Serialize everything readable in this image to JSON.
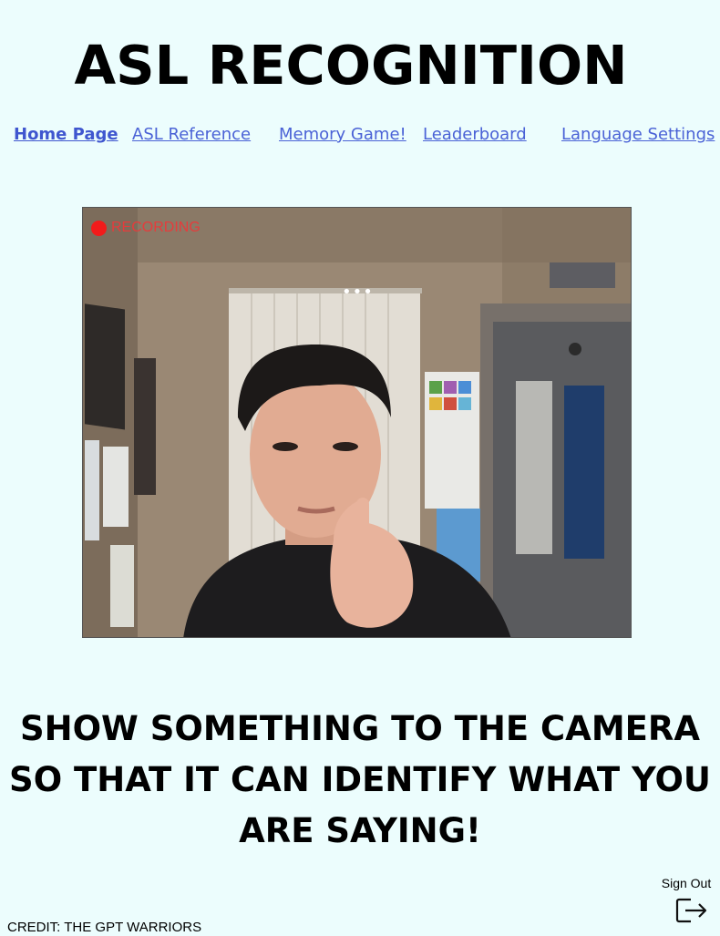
{
  "app": {
    "title": "ASL RECOGNITION"
  },
  "nav": {
    "items": [
      {
        "label": "Home Page",
        "active": true
      },
      {
        "label": "ASL Reference",
        "active": false
      },
      {
        "label": "Memory Game!",
        "active": false
      },
      {
        "label": "Leaderboard",
        "active": false
      },
      {
        "label": "Language Settings",
        "active": false
      }
    ]
  },
  "camera": {
    "status_label": "RECORDING",
    "status_color": "#f21b1b",
    "menu_icon": "more-horizontal-icon"
  },
  "prompt": {
    "lines": [
      "SHOW SOMETHING TO THE CAMERA",
      "SO THAT IT CAN IDENTIFY WHAT YOU",
      "ARE SAYING!"
    ]
  },
  "footer": {
    "credit": "CREDIT: THE GPT WARRIORS",
    "sign_out_label": "Sign Out",
    "sign_out_icon": "log-out-icon"
  },
  "colors": {
    "background": "#ecfdfd",
    "link": "#4a62d6",
    "recording": "#e53c3c"
  }
}
